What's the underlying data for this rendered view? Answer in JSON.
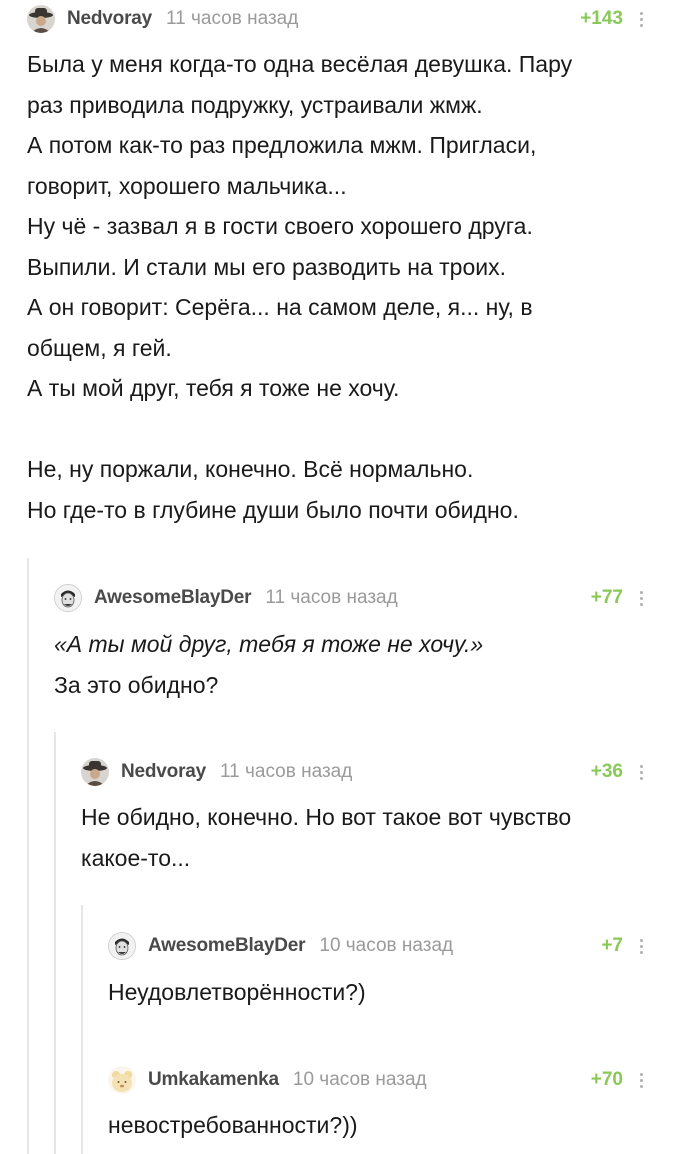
{
  "comments": [
    {
      "author": "Nedvoray",
      "time": "11 часов назад",
      "rating": "+143",
      "avatar_icon": "cowboy-hat-avatar-icon",
      "lines_a": [
        "Была у меня когда-то одна весёлая девушка. Пару",
        "раз приводила подружку, устраивали жмж.",
        "А потом как-то раз предложила мжм. Пригласи,",
        "говорит, хорошего мальчика...",
        "Ну чё - зазвал я в гости своего хорошего друга.",
        "Выпили. И стали мы его разводить на троих.",
        "А он говорит: Серёга... на самом деле, я... ну, в",
        "общем, я гей.",
        "А ты мой друг, тебя я тоже не хочу."
      ],
      "lines_b": [
        "Не, ну поржали, конечно. Всё нормально.",
        "Но где-то в глубине души было почти обидно."
      ]
    },
    {
      "author": "AwesomeBlayDer",
      "time": "11 часов назад",
      "rating": "+77",
      "avatar_icon": "face-sketch-avatar-icon",
      "quote": "«А ты мой друг, тебя я тоже не хочу.»",
      "line": "За это обидно?"
    },
    {
      "author": "Nedvoray",
      "time": "11 часов назад",
      "rating": "+36",
      "avatar_icon": "cowboy-hat-avatar-icon",
      "lines": [
        "Не обидно, конечно. Но вот такое вот чувство",
        "какое-то..."
      ]
    },
    {
      "author": "AwesomeBlayDer",
      "time": "10 часов назад",
      "rating": "+7",
      "avatar_icon": "face-sketch-avatar-icon",
      "line": "Неудовлетворённости?)"
    },
    {
      "author": "Umkakamenka",
      "time": "10 часов назад",
      "rating": "+70",
      "avatar_icon": "bear-avatar-icon",
      "line": "невостребованности?))"
    }
  ],
  "colors": {
    "rating": "#8ac858",
    "thread_line": "#e6e6e6",
    "author": "#4a4a4a",
    "time": "#9a9a9a"
  }
}
